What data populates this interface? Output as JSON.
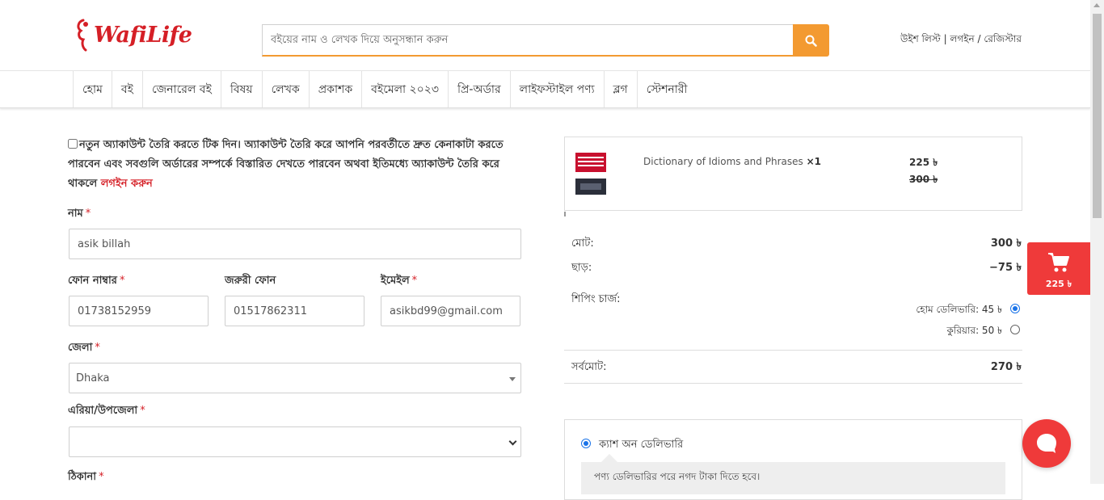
{
  "header": {
    "logo_text": "WafiLife",
    "search_placeholder": "বইয়ের নাম ও লেখক দিয়ে অনুসন্ধান করুন",
    "wishlist_label": "উইশ লিস্ট",
    "login_label": "লগইন",
    "register_label": "রেজিস্টার"
  },
  "nav": {
    "items": [
      "হোম",
      "বই",
      "জেনারেল বই",
      "বিষয়",
      "লেখক",
      "প্রকাশক",
      "বইমেলা ২০২৩",
      "প্রি-অর্ডার",
      "লাইফস্টাইল পণ্য",
      "ব্লগ",
      "স্টেশনারী"
    ]
  },
  "form": {
    "create_account_text": "নতুন অ্যাকাউন্ট তৈরি করতে টিক দিন। অ্যাকাউন্ট তৈরি করে আপনি পরবর্তীতে দ্রুত কেনাকাটা করতে পারবেন এবং সবগুলি অর্ডারের সম্পর্কে বিস্তারিত দেখতে পারবেন অথবা ইতিমধ্যে অ্যাকাউন্ট তৈরি করে থাকলে",
    "login_link": "লগইন করুন",
    "required_mark": "*",
    "name_label": "নাম",
    "name_value": "asik billah",
    "phone_label": "ফোন নাম্বার",
    "phone_value": "01738152959",
    "alt_phone_label": "জরুরী ফোন",
    "alt_phone_value": "01517862311",
    "email_label": "ইমেইল",
    "email_value": "asikbd99@gmail.com",
    "district_label": "জেলা",
    "district_value": "Dhaka",
    "area_label": "এরিয়া/উপজেলা",
    "area_value": "",
    "address_label": "ঠিকানা"
  },
  "order": {
    "item_title": "Dictionary of Idioms and Phrases",
    "item_qty": "×1",
    "item_price": "225 ৳",
    "item_old_price": "300 ৳",
    "subtotal_label": "মোট:",
    "subtotal_value": "300 ৳",
    "discount_label": "ছাড়:",
    "discount_value": "−75 ৳",
    "shipping_label": "শিপিং চার্জ:",
    "shipping_options": [
      {
        "label": "হোম ডেলিভারি: 45 ৳",
        "checked": true
      },
      {
        "label": "কুরিয়ার: 50 ৳",
        "checked": false
      }
    ],
    "total_label": "সর্বমোট:",
    "total_value": "270 ৳"
  },
  "payment": {
    "method_label": "ক্যাশ অন ডেলিভারি",
    "method_note": "পণ্য ডেলিভারির পরে নগদ টাকা দিতে হবে।"
  },
  "cart": {
    "amount": "225 ৳"
  },
  "colors": {
    "brand_red": "#d51f26",
    "search_orange": "#f39a31",
    "float_red": "#ef3a3a",
    "radio_blue": "#1a73e8"
  }
}
